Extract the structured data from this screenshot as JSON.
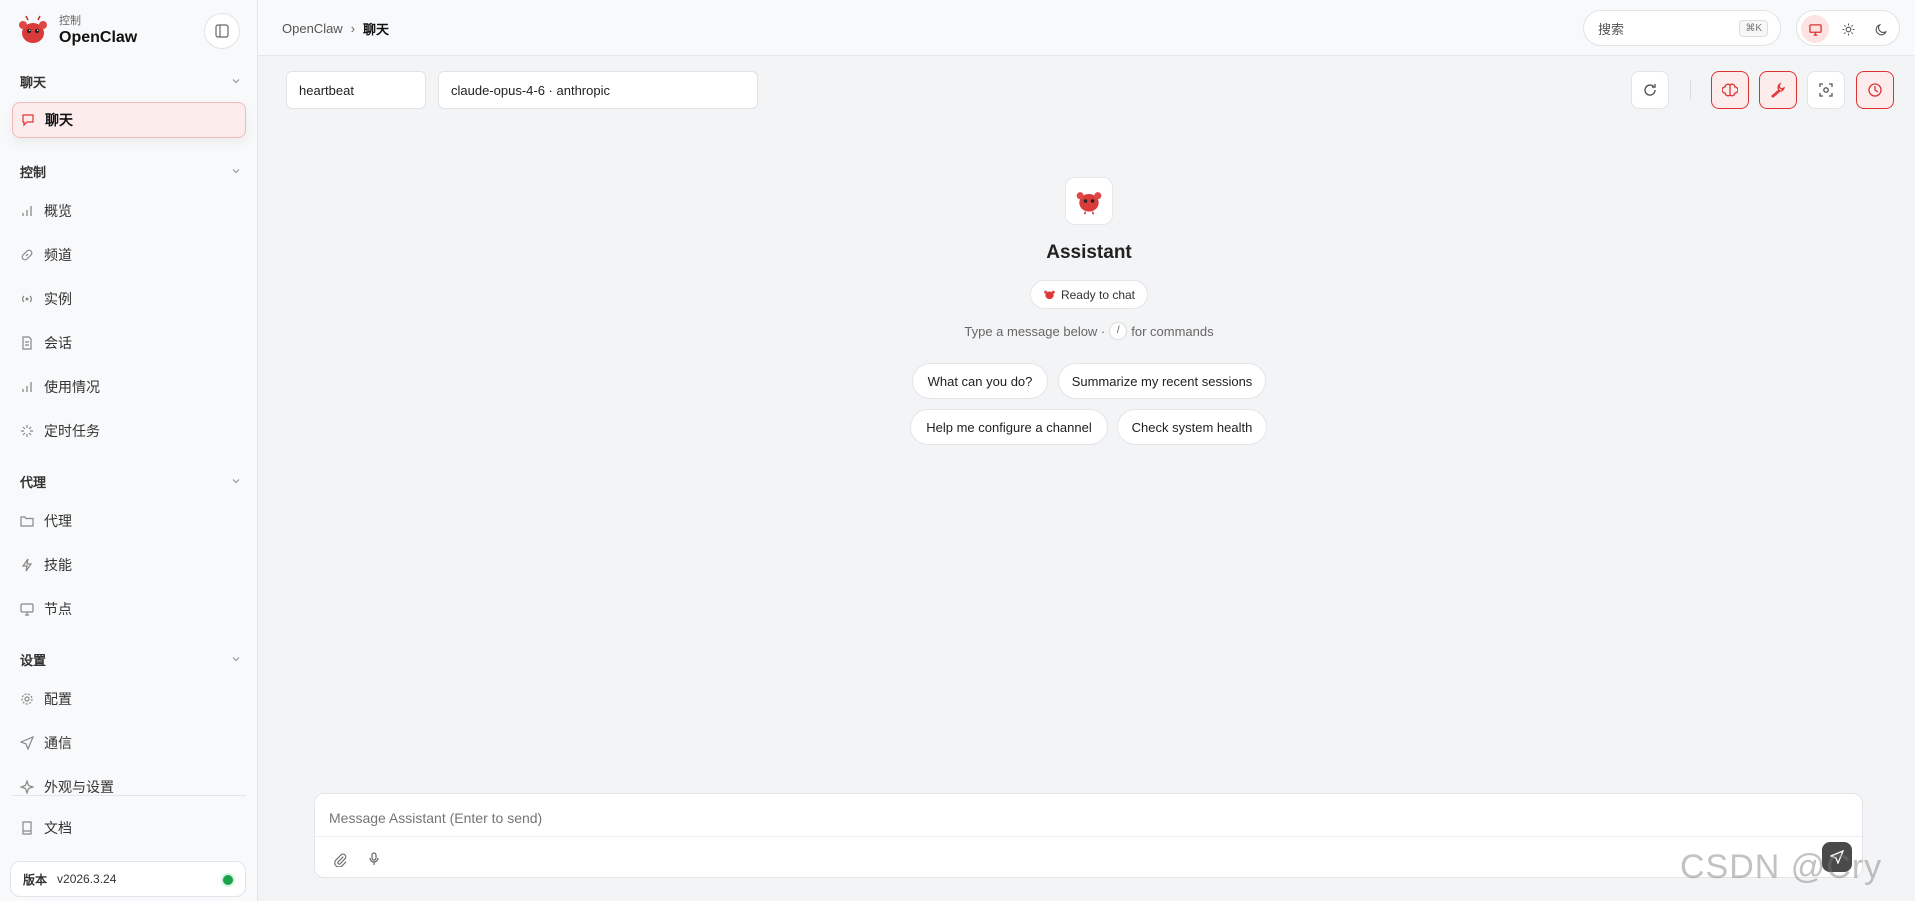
{
  "brand": {
    "sub": "控制",
    "name": "OpenClaw"
  },
  "sidebar": {
    "sections": [
      {
        "title": "聊天",
        "items": [
          {
            "label": "聊天",
            "icon": "chat-bubble-icon",
            "active": true
          }
        ]
      },
      {
        "title": "控制",
        "items": [
          {
            "label": "概览",
            "icon": "bar-chart-icon"
          },
          {
            "label": "频道",
            "icon": "link-icon"
          },
          {
            "label": "实例",
            "icon": "broadcast-icon"
          },
          {
            "label": "会话",
            "icon": "document-icon"
          },
          {
            "label": "使用情况",
            "icon": "bar-chart-icon"
          },
          {
            "label": "定时任务",
            "icon": "spinner-icon"
          }
        ]
      },
      {
        "title": "代理",
        "items": [
          {
            "label": "代理",
            "icon": "folder-icon"
          },
          {
            "label": "技能",
            "icon": "lightning-icon"
          },
          {
            "label": "节点",
            "icon": "monitor-icon"
          }
        ]
      },
      {
        "title": "设置",
        "items": [
          {
            "label": "配置",
            "icon": "gear-icon"
          },
          {
            "label": "通信",
            "icon": "send-icon"
          },
          {
            "label": "外观与设置",
            "icon": "sparkle-icon"
          }
        ]
      }
    ],
    "docs": {
      "label": "文档",
      "icon": "book-icon"
    },
    "version": {
      "label": "版本",
      "value": "v2026.3.24"
    }
  },
  "breadcrumb": {
    "root": "OpenClaw",
    "sep": "›",
    "current": "聊天"
  },
  "search": {
    "placeholder": "搜索",
    "shortcut": "⌘K"
  },
  "session": {
    "name": "heartbeat",
    "model": "claude-opus-4-6 · anthropic"
  },
  "assistant": {
    "title": "Assistant",
    "status": "Ready to chat",
    "hint_before": "Type a message below ·",
    "hint_key": "/",
    "hint_after": "for commands"
  },
  "suggestions": [
    "What can you do?",
    "Summarize my recent sessions",
    "Help me configure a channel",
    "Check system health"
  ],
  "composer": {
    "placeholder": "Message Assistant (Enter to send)"
  },
  "watermark": "CSDN @Cry",
  "colors": {
    "accent": "#dc3a3a",
    "status_ok": "#16a34a"
  }
}
